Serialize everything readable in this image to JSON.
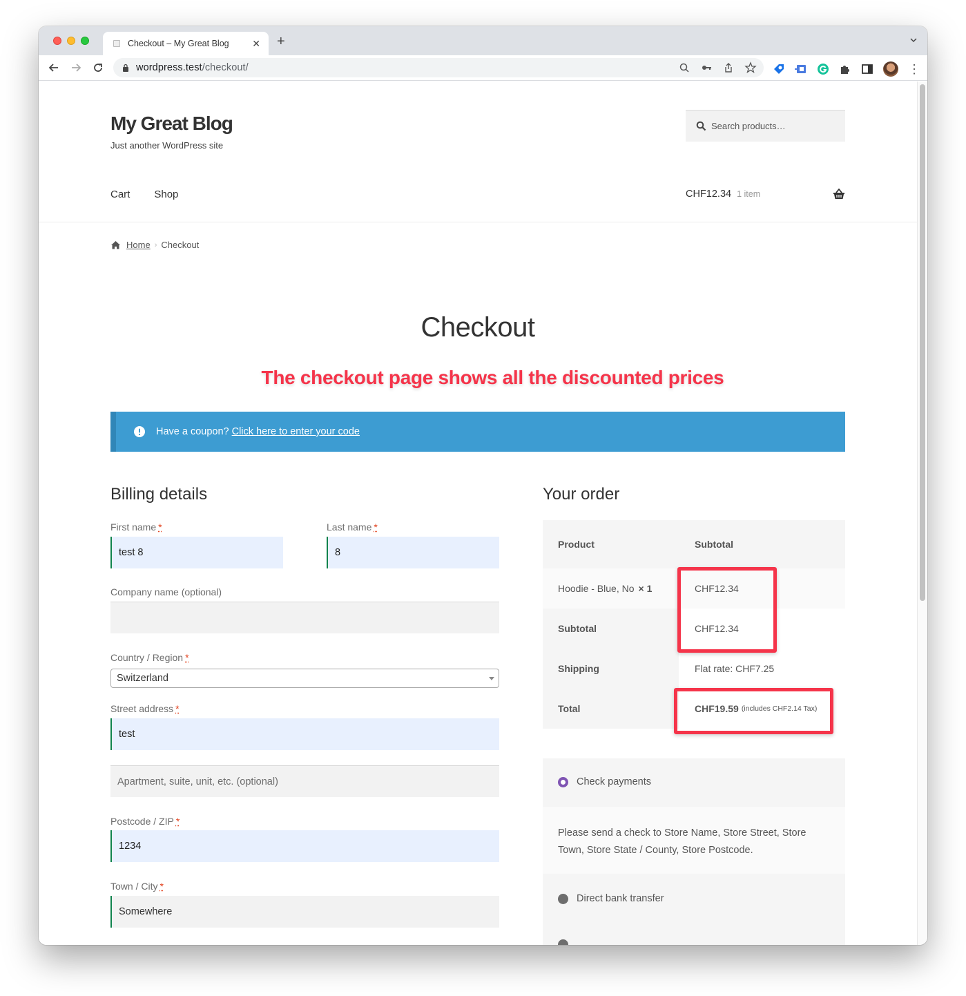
{
  "browser": {
    "tab_title": "Checkout – My Great Blog",
    "url_host": "wordpress.test",
    "url_path": "/checkout/"
  },
  "site": {
    "title": "My Great Blog",
    "tagline": "Just another WordPress site",
    "search_placeholder": "Search products…",
    "nav": [
      {
        "label": "Cart"
      },
      {
        "label": "Shop"
      }
    ],
    "mini_cart": {
      "amount": "CHF12.34",
      "count": "1 item"
    }
  },
  "breadcrumb": {
    "home": "Home",
    "current": "Checkout"
  },
  "page": {
    "title": "Checkout",
    "annotation": "The checkout page shows all the discounted prices",
    "annotation_color": "#f5344a"
  },
  "coupon": {
    "text": "Have a coupon?",
    "link": "Click here to enter your code"
  },
  "billing": {
    "heading": "Billing details",
    "first_name": {
      "label": "First name",
      "value": "test 8"
    },
    "last_name": {
      "label": "Last name",
      "value": "8"
    },
    "company": {
      "label": "Company name (optional)",
      "value": ""
    },
    "country": {
      "label": "Country / Region",
      "value": "Switzerland"
    },
    "street": {
      "label": "Street address",
      "value": "test",
      "placeholder2": "Apartment, suite, unit, etc. (optional)"
    },
    "postcode": {
      "label": "Postcode / ZIP",
      "value": "1234"
    },
    "city": {
      "label": "Town / City",
      "value": "Somewhere"
    },
    "required_mark": "*"
  },
  "order": {
    "heading": "Your order",
    "col_product": "Product",
    "col_subtotal": "Subtotal",
    "items": [
      {
        "name": "Hoodie - Blue, No",
        "qty": "× 1",
        "subtotal": "CHF12.34"
      }
    ],
    "subtotal_label": "Subtotal",
    "subtotal_value": "CHF12.34",
    "shipping_label": "Shipping",
    "shipping_value": "Flat rate: CHF7.25",
    "total_label": "Total",
    "total_value": "CHF19.59",
    "tax_note": "(includes CHF2.14 Tax)"
  },
  "payment": {
    "methods": [
      {
        "label": "Check payments",
        "selected": true
      },
      {
        "label": "Direct bank transfer",
        "selected": false
      }
    ],
    "check_description": "Please send a check to Store Name, Store Street, Store Town, Store State / County, Store Postcode."
  }
}
